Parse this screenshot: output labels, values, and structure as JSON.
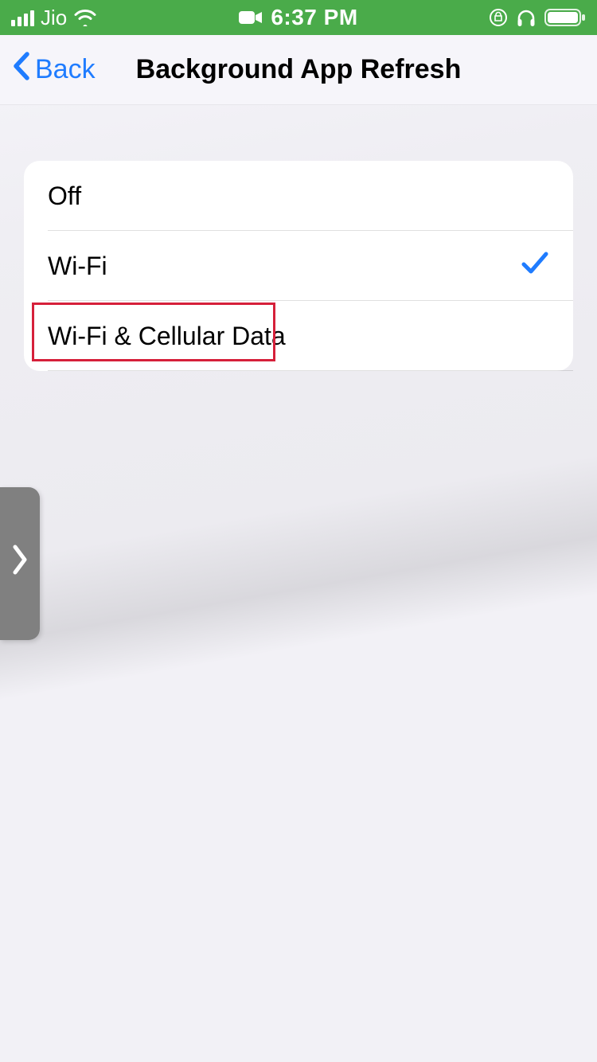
{
  "status": {
    "carrier": "Jio",
    "time": "6:37 PM"
  },
  "nav": {
    "back_label": "Back",
    "title": "Background App Refresh"
  },
  "options": [
    {
      "label": "Off",
      "selected": false,
      "highlighted": false
    },
    {
      "label": "Wi-Fi",
      "selected": true,
      "highlighted": false
    },
    {
      "label": "Wi-Fi & Cellular Data",
      "selected": false,
      "highlighted": true
    }
  ],
  "colors": {
    "status_bg": "#4aab4a",
    "accent": "#1f7cff",
    "highlight_border": "#d6203a"
  }
}
